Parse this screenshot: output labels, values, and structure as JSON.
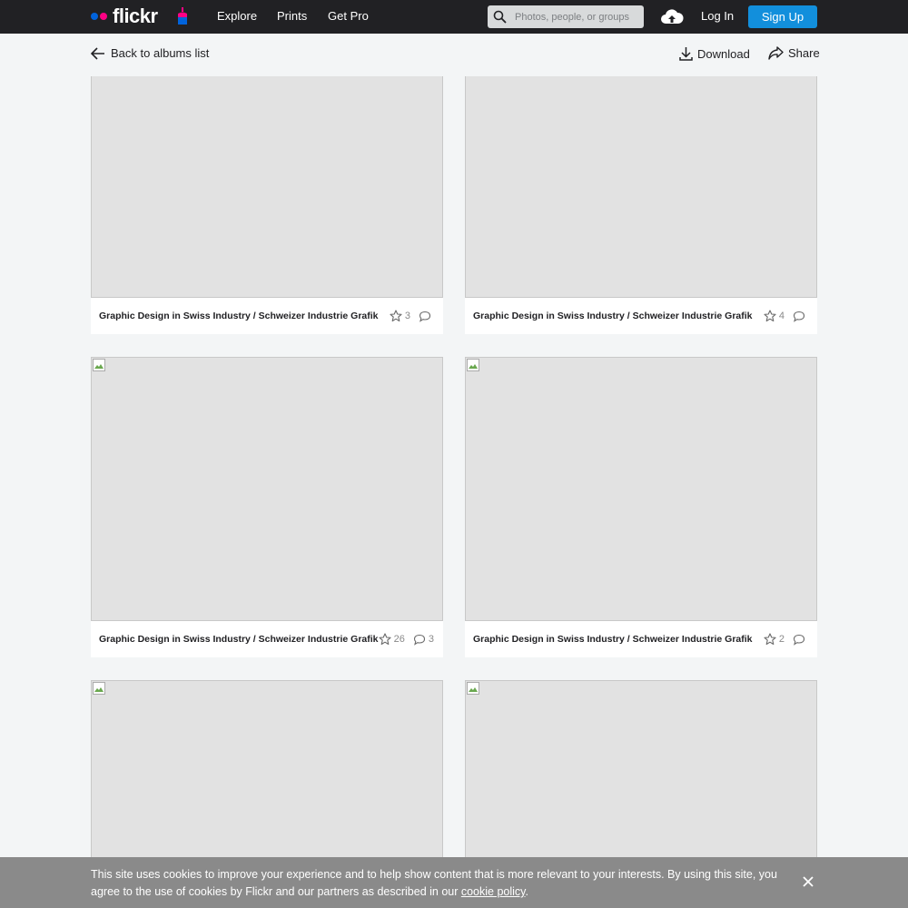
{
  "nav": {
    "logo": "flickr",
    "links": [
      "Explore",
      "Prints",
      "Get Pro"
    ],
    "search_placeholder": "Photos, people, or groups",
    "login": "Log In",
    "signup": "Sign Up",
    "colors": {
      "bar": "#212124",
      "accent": "#128fdc",
      "logo_blue": "#0063dc",
      "logo_pink": "#ff0084"
    }
  },
  "subbar": {
    "back": "Back to albums list",
    "download": "Download",
    "share": "Share"
  },
  "photos": [
    {
      "title": "Graphic Design in Swiss Industry / Schweizer Industrie Grafik",
      "faves": "3",
      "comments": ""
    },
    {
      "title": "Graphic Design in Swiss Industry / Schweizer Industrie Grafik",
      "faves": "4",
      "comments": ""
    },
    {
      "title": "Graphic Design in Swiss Industry / Schweizer Industrie Grafik",
      "faves": "26",
      "comments": "3"
    },
    {
      "title": "Graphic Design in Swiss Industry / Schweizer Industrie Grafik",
      "faves": "2",
      "comments": ""
    }
  ],
  "cookie": {
    "text_before": "This site uses cookies to improve your experience and to help show content that is more relevant to your interests. By using this site, you agree to the use of cookies by Flickr and our partners as described in our ",
    "link": "cookie policy",
    "text_after": "."
  }
}
